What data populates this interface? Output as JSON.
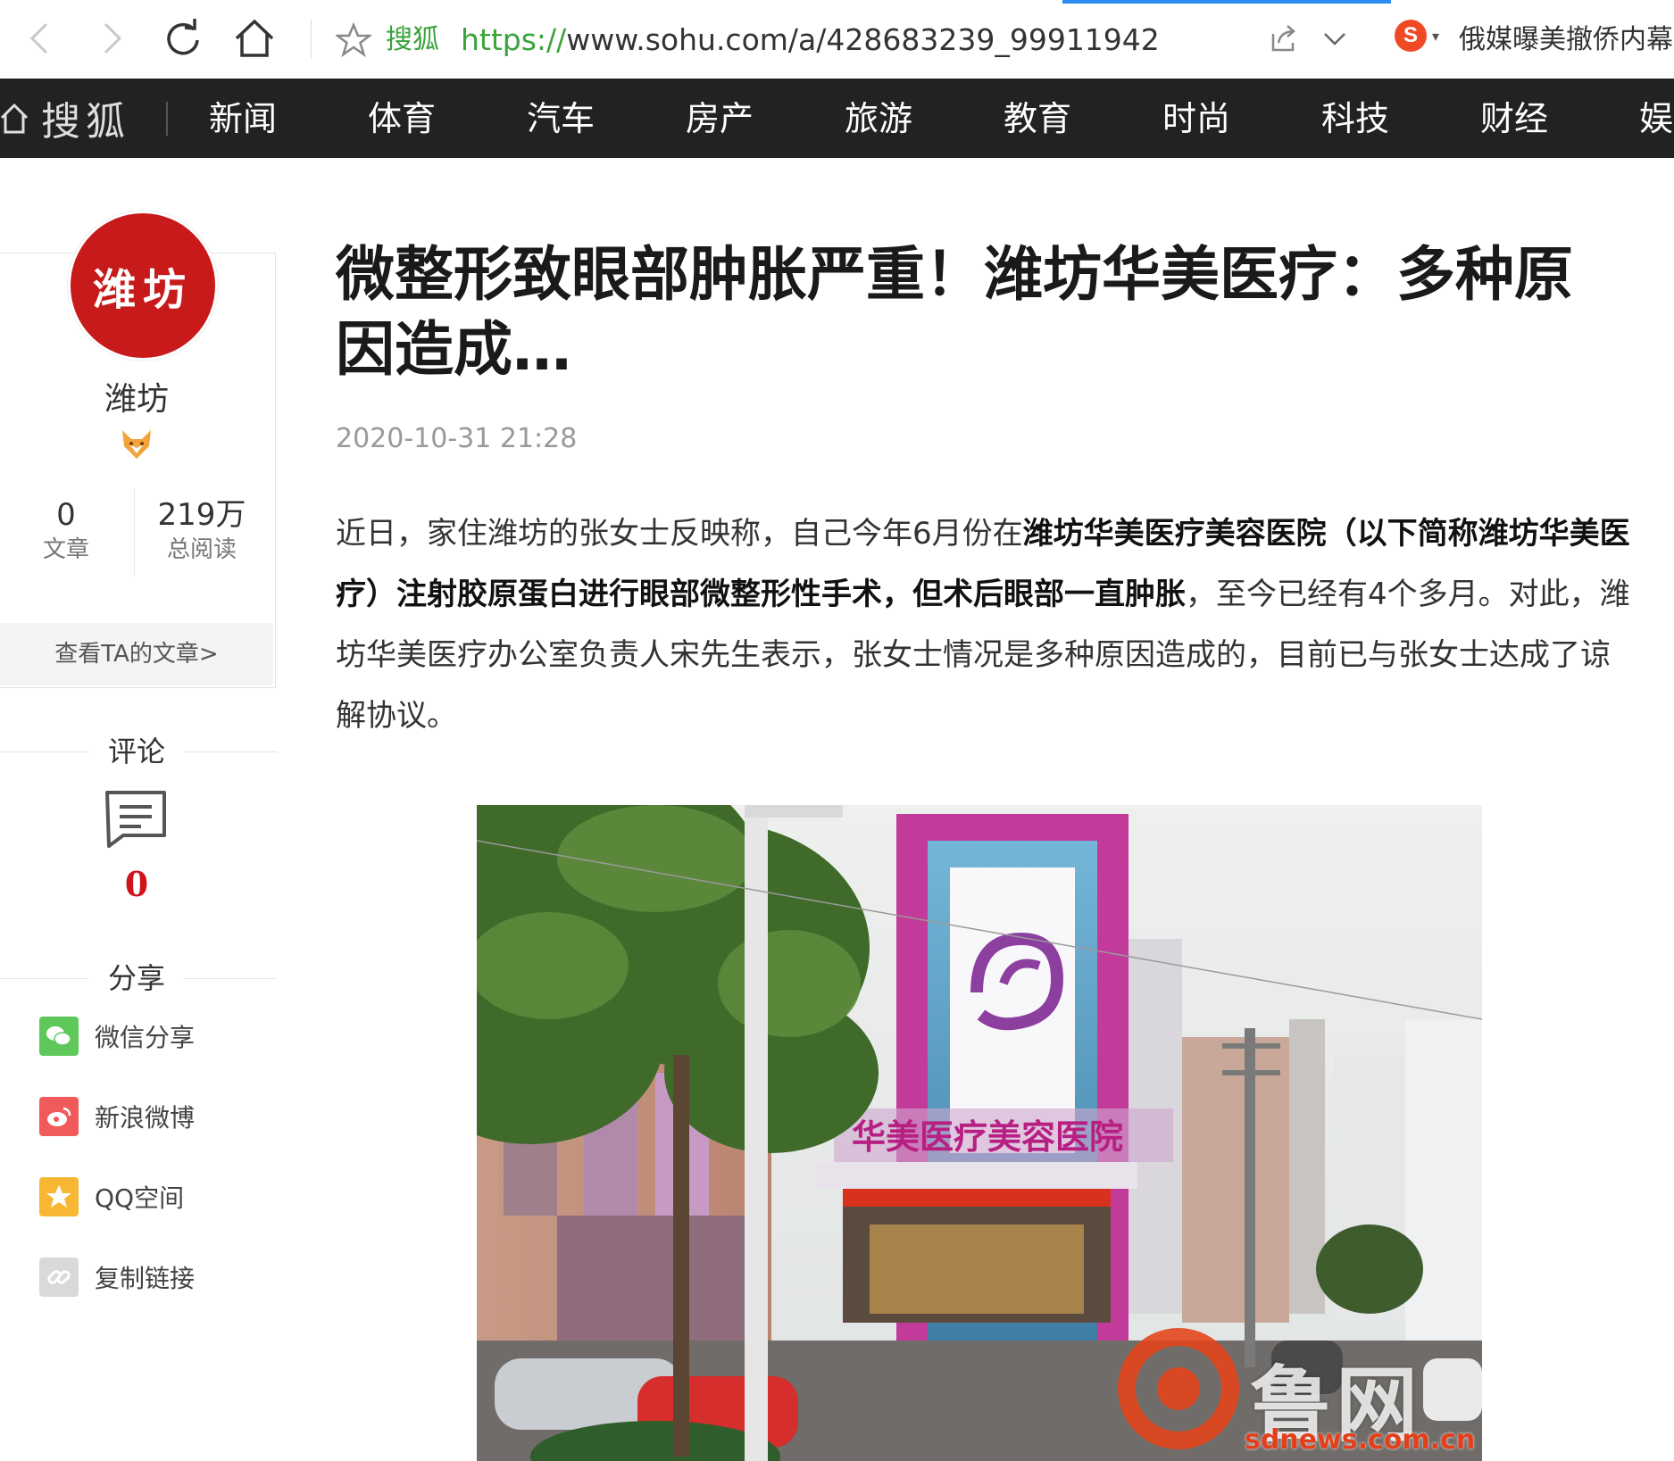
{
  "browser": {
    "site_name": "搜狐",
    "url_scheme": "https://",
    "url_rest": "www.sohu.com/a/428683239_99911942",
    "sogou_letter": "S",
    "extension_text": "俄媒曝美撤侨内幕"
  },
  "header": {
    "logo_text": "搜狐",
    "nav_items": [
      "新闻",
      "体育",
      "汽车",
      "房产",
      "旅游",
      "教育",
      "时尚",
      "科技",
      "财经",
      "娱乐"
    ]
  },
  "sidebar": {
    "avatar_text": "潍坊",
    "author_name": "潍坊",
    "stats": [
      {
        "value": "0",
        "label": "文章"
      },
      {
        "value": "219万",
        "label": "总阅读"
      }
    ],
    "more_link": "查看TA的文章>",
    "comments_heading": "评论",
    "comments_count": "0",
    "share_heading": "分享",
    "share_items": [
      {
        "label": "微信分享",
        "icon": "wechat-icon",
        "color": "#5ec95a"
      },
      {
        "label": "新浪微博",
        "icon": "weibo-icon",
        "color": "#f05a5a"
      },
      {
        "label": "QQ空间",
        "icon": "qzone-star-icon",
        "color": "#f7b733"
      },
      {
        "label": "复制链接",
        "icon": "link-icon",
        "color": "#d9d9d9"
      }
    ]
  },
  "article": {
    "title": "微整形致眼部肿胀严重！潍坊华美医疗：多种原因造成…",
    "date": "2020-10-31 21:28",
    "body_parts": [
      "近日，家住潍坊的张女士反映称，自己今年6月份在",
      "潍坊华美医疗美容医院（以下简称潍坊华美医疗）注射胶原蛋白进行眼部微整形性手术，但术后眼部一直肿胀",
      "，至今已经有4个多月。对此，潍坊华美医疗办公室负责人宋先生表示，张女士情况是多种原因造成的，目前已与张女士达成了谅解协议。"
    ],
    "photo": {
      "sign_text": "华美医疗美容医院",
      "watermark_text": "鲁网",
      "watermark_url": "sdnews.com.cn"
    }
  },
  "colors": {
    "nav_bg": "#222222",
    "avatar_red": "#c81a1a",
    "site_green": "#3aa33a",
    "comment_red": "#d0121b"
  }
}
